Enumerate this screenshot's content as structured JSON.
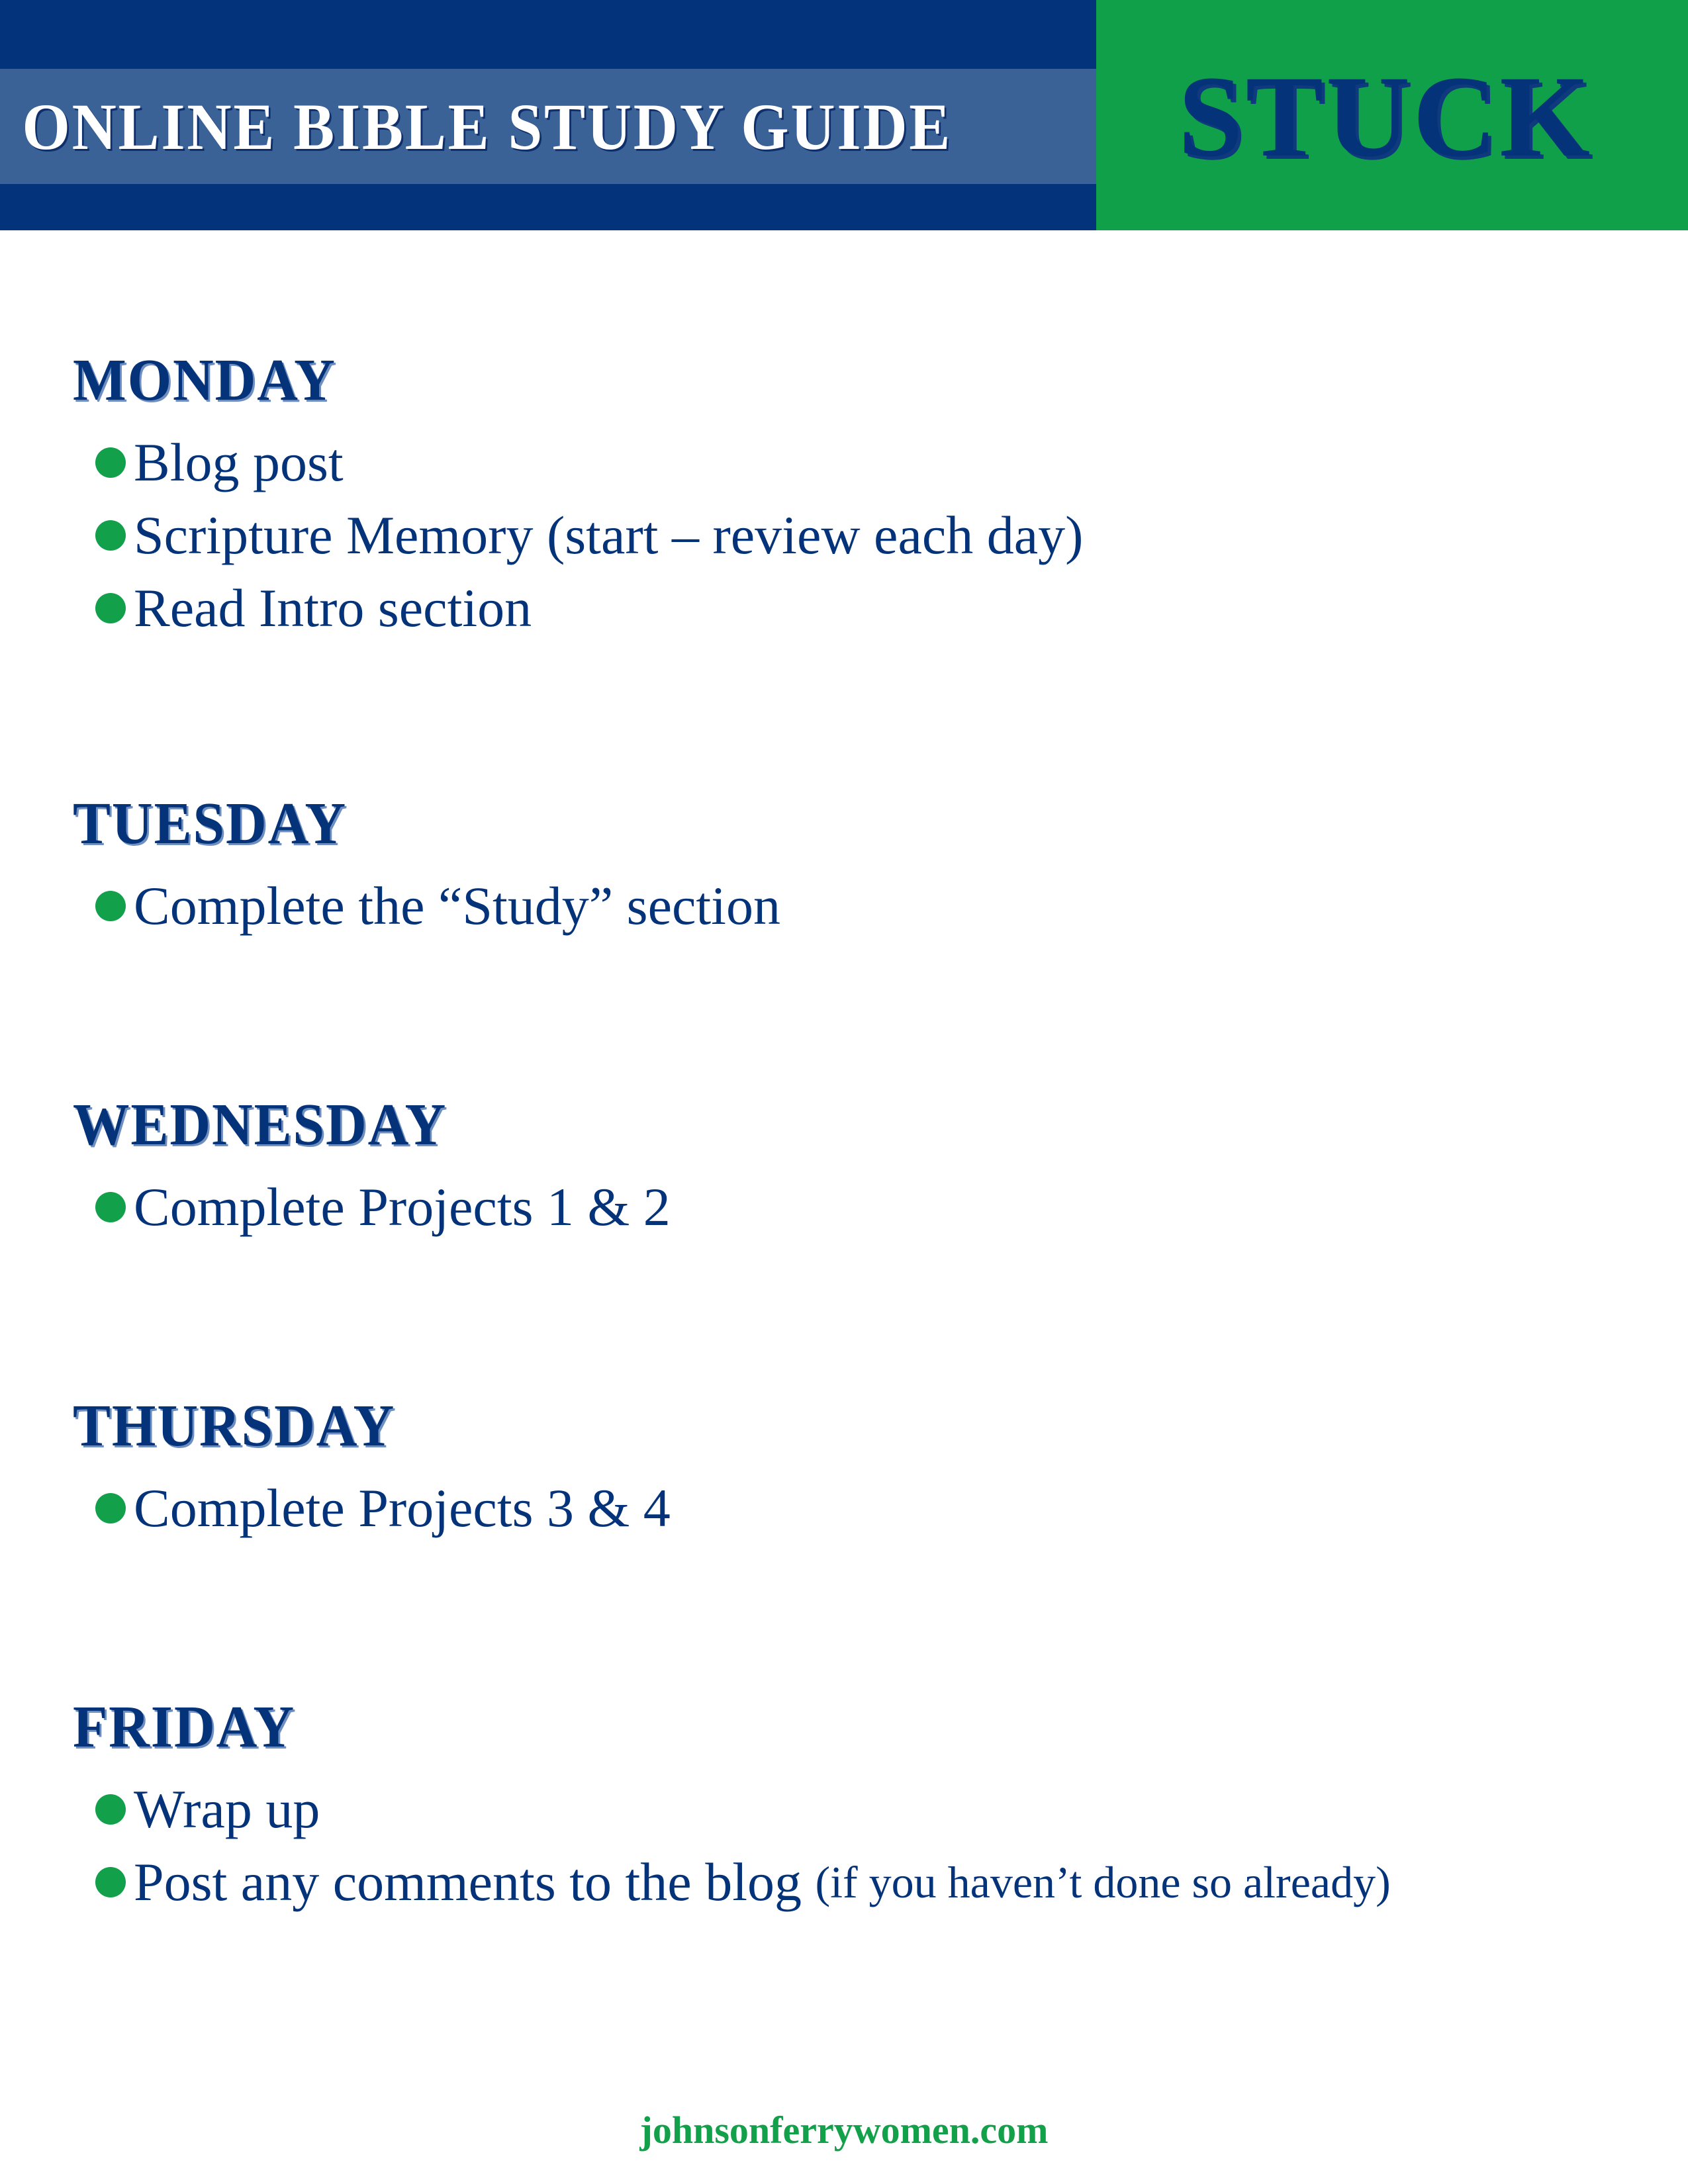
{
  "header": {
    "title": "ONLINE BIBLE STUDY GUIDE",
    "study_name": "STUCK"
  },
  "colors": {
    "navy": "#03337a",
    "band_blue": "#3a6296",
    "green": "#11a04a",
    "text_navy": "#05337a"
  },
  "days": [
    {
      "name": "MONDAY",
      "items": [
        {
          "text": "Blog post",
          "aside": ""
        },
        {
          "text": "Scripture Memory (start – review each day)",
          "aside": ""
        },
        {
          "text": "Read Intro section",
          "aside": ""
        }
      ]
    },
    {
      "name": "TUESDAY",
      "items": [
        {
          "text": "Complete the “Study” section",
          "aside": ""
        }
      ]
    },
    {
      "name": "WEDNESDAY",
      "items": [
        {
          "text": "Complete Projects 1 & 2",
          "aside": ""
        }
      ]
    },
    {
      "name": "THURSDAY",
      "items": [
        {
          "text": "Complete Projects 3 & 4",
          "aside": ""
        }
      ]
    },
    {
      "name": "FRIDAY",
      "items": [
        {
          "text": "Wrap up",
          "aside": ""
        },
        {
          "text": "Post any comments to the blog ",
          "aside": "(if you haven’t done so already)"
        }
      ]
    }
  ],
  "footer": {
    "website": "johnsonferrywomen.com"
  }
}
